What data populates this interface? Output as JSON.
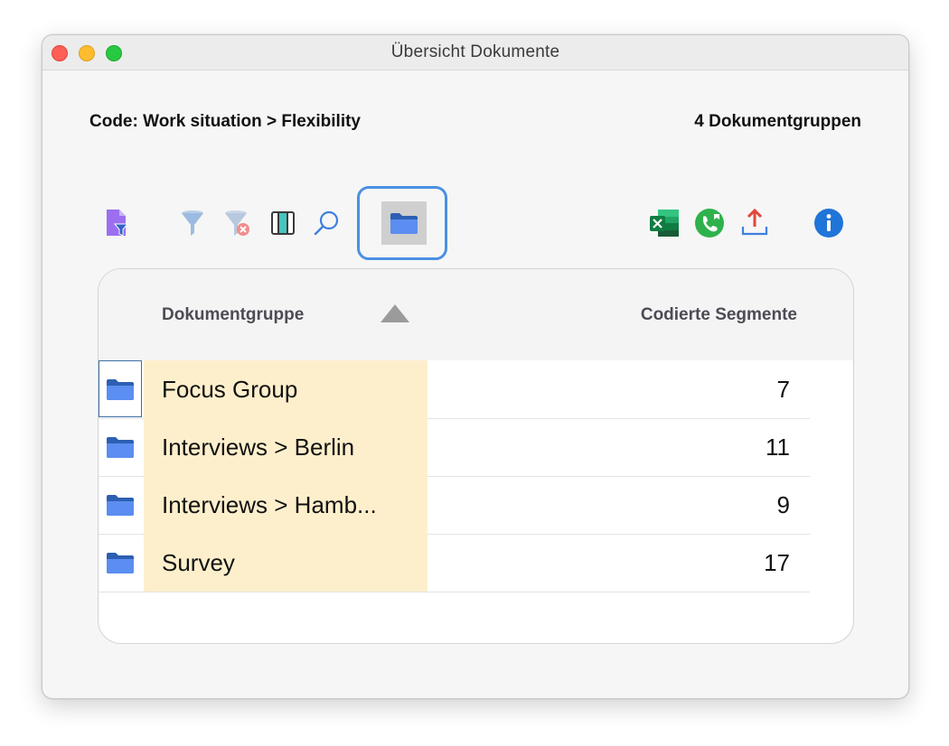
{
  "window": {
    "title": "Übersicht Dokumente"
  },
  "info": {
    "code_label": "Code: Work situation > Flexibility",
    "group_count": "4 Dokumentgruppen"
  },
  "toolbar": {
    "icons": [
      "document-filter-icon",
      "filter-icon",
      "clear-filter-icon",
      "columns-icon",
      "search-icon",
      "folder-icon",
      "excel-icon",
      "phone-icon",
      "export-icon",
      "info-icon"
    ],
    "active": "folder-icon",
    "accent": "#4a90e2"
  },
  "table": {
    "columns": {
      "group": "Dokumentgruppe",
      "count": "Codierte Segmente"
    },
    "sort": "ascending",
    "rows": [
      {
        "name": "Focus Group",
        "count": "7",
        "selected": true
      },
      {
        "name": "Interviews > Berlin",
        "count": "11",
        "selected": false
      },
      {
        "name": "Interviews > Hamb...",
        "count": "9",
        "selected": false
      },
      {
        "name": "Survey",
        "count": "17",
        "selected": false
      }
    ]
  }
}
